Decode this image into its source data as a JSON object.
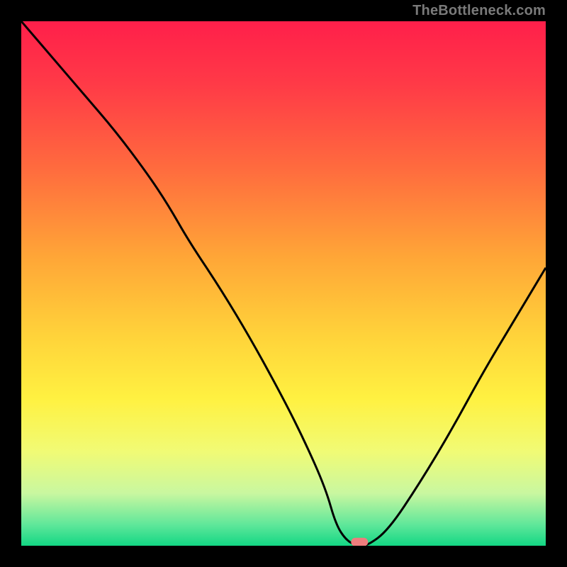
{
  "attribution": "TheBottleneck.com",
  "colors": {
    "frame": "#000000",
    "curve": "#000000",
    "marker": "#ee7d7d",
    "gradient_stops": [
      {
        "offset": 0.0,
        "color": "#ff1f4a"
      },
      {
        "offset": 0.12,
        "color": "#ff3a47"
      },
      {
        "offset": 0.28,
        "color": "#ff6b3e"
      },
      {
        "offset": 0.45,
        "color": "#ffa637"
      },
      {
        "offset": 0.6,
        "color": "#ffd33a"
      },
      {
        "offset": 0.72,
        "color": "#fff141"
      },
      {
        "offset": 0.82,
        "color": "#f1fb75"
      },
      {
        "offset": 0.9,
        "color": "#c9f7a0"
      },
      {
        "offset": 0.96,
        "color": "#5fe79a"
      },
      {
        "offset": 1.0,
        "color": "#13d784"
      }
    ]
  },
  "chart_data": {
    "type": "line",
    "title": "",
    "xlabel": "",
    "ylabel": "",
    "xlim": [
      0,
      100
    ],
    "ylim": [
      0,
      100
    ],
    "series": [
      {
        "name": "bottleneck-curve",
        "x": [
          0,
          6,
          12,
          18,
          24,
          28,
          32,
          38,
          44,
          50,
          54,
          58,
          60,
          62,
          64,
          66,
          70,
          76,
          82,
          88,
          94,
          100
        ],
        "y": [
          100,
          93,
          86,
          79,
          71,
          65,
          58,
          49,
          39,
          28,
          20,
          11,
          4,
          1,
          0,
          0,
          3,
          12,
          22,
          33,
          43,
          53
        ]
      }
    ],
    "marker": {
      "x": 64.5,
      "y": 0.7
    }
  }
}
